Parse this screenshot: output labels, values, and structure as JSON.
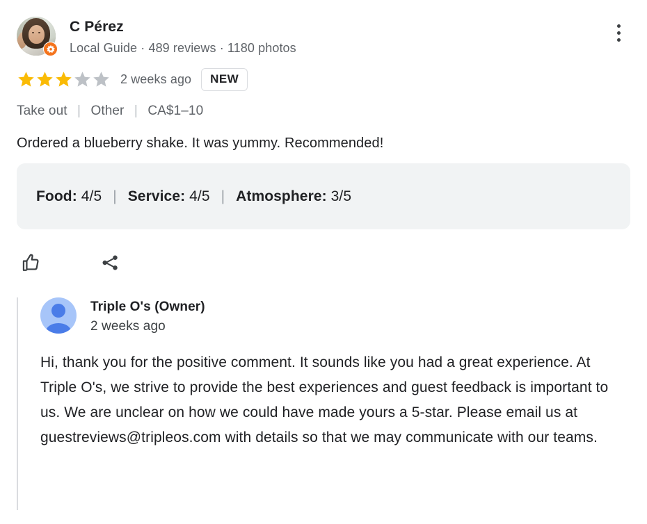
{
  "reviewer": {
    "name": "C Pérez",
    "meta": "Local Guide · 489 reviews · 1180 photos",
    "avatar_icon": "user-photo-avatar",
    "badge_icon": "local-guide-badge-icon"
  },
  "menu": {
    "icon": "more-vertical-icon",
    "label": "More options"
  },
  "rating": {
    "stars_filled": 3,
    "stars_total": 5,
    "filled_color": "#fabb05",
    "empty_color": "#bdc1c6",
    "age": "2 weeks ago",
    "new_badge": "NEW"
  },
  "attributes": {
    "items": [
      "Take out",
      "Other",
      "CA$1–10"
    ],
    "separator": "|"
  },
  "review": {
    "text": "Ordered a blueberry shake. It was yummy. Recommended!"
  },
  "sub_ratings": {
    "separator": "|",
    "items": [
      {
        "label": "Food:",
        "value": "4/5"
      },
      {
        "label": "Service:",
        "value": "4/5"
      },
      {
        "label": "Atmosphere:",
        "value": "3/5"
      }
    ]
  },
  "actions": {
    "like": {
      "icon": "thumbs-up-icon",
      "label": "Like"
    },
    "share": {
      "icon": "share-icon",
      "label": "Share"
    }
  },
  "owner_reply": {
    "avatar_icon": "person-avatar-icon",
    "name": "Triple O's (Owner)",
    "age": "2 weeks ago",
    "text": "Hi, thank you for the positive comment. It sounds like you had a great experience. At Triple O's, we strive to provide the best experiences and guest feedback is important to us. We are unclear on how we could have made yours a 5-star. Please email us at guestreviews@tripleos.com with details so that we may communicate with our teams."
  }
}
